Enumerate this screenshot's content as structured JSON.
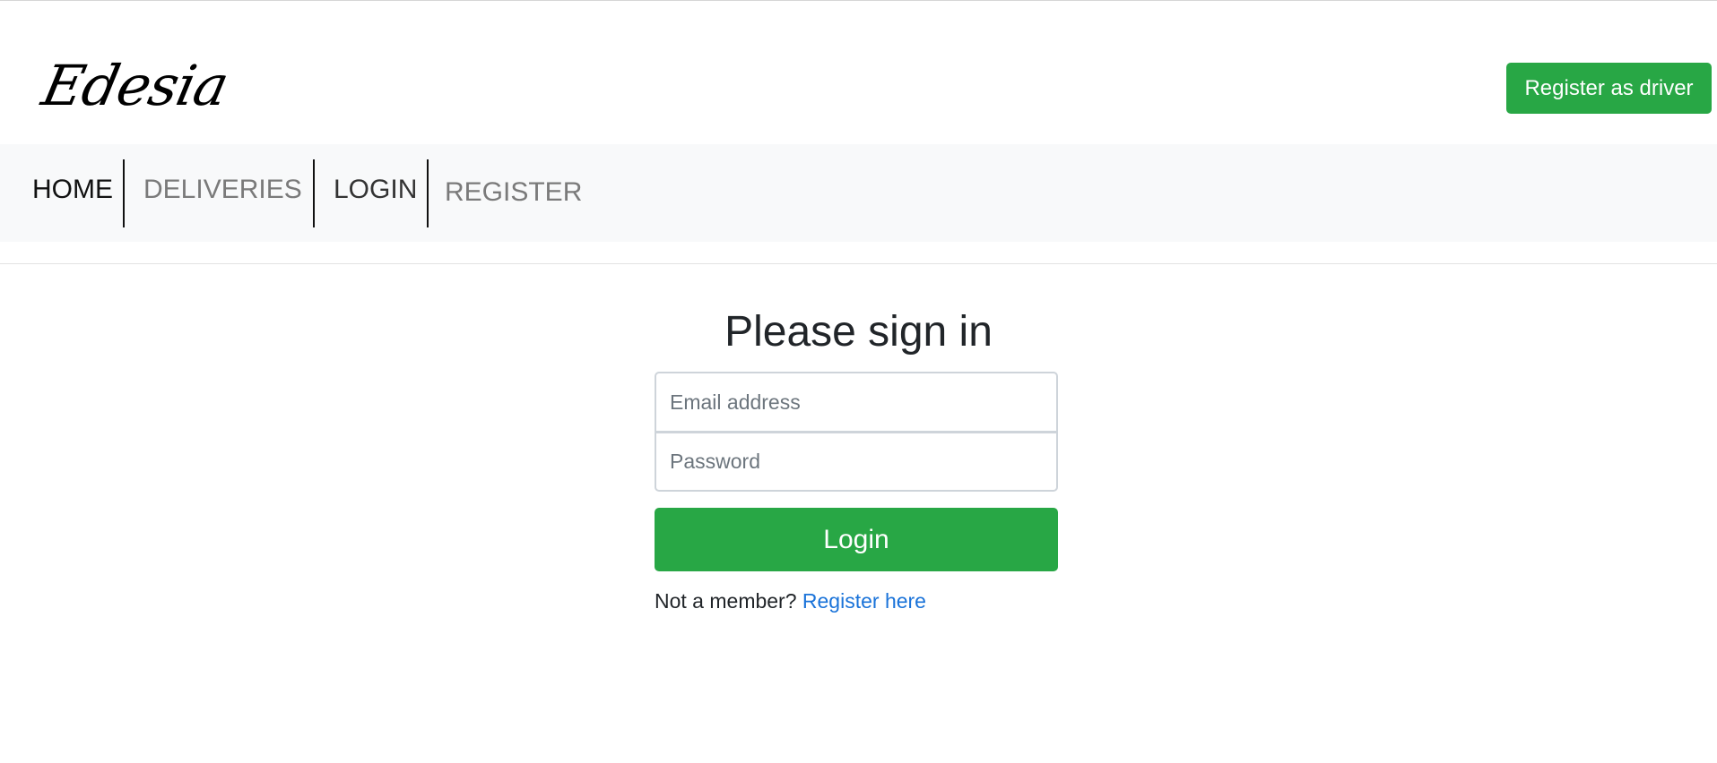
{
  "header": {
    "brand": "Edesia",
    "register_driver_label": "Register as driver"
  },
  "nav": {
    "items": [
      {
        "label": "HOME"
      },
      {
        "label": "DELIVERIES"
      },
      {
        "label": "LOGIN"
      },
      {
        "label": "REGISTER"
      }
    ]
  },
  "signin": {
    "title": "Please sign in",
    "email_placeholder": "Email address",
    "password_placeholder": "Password",
    "login_label": "Login",
    "member_prompt": "Not a member?",
    "register_link": "Register here"
  },
  "colors": {
    "accent_green": "#28a745",
    "link_blue": "#1a73d9",
    "navbar_bg": "#f8f9fa"
  }
}
